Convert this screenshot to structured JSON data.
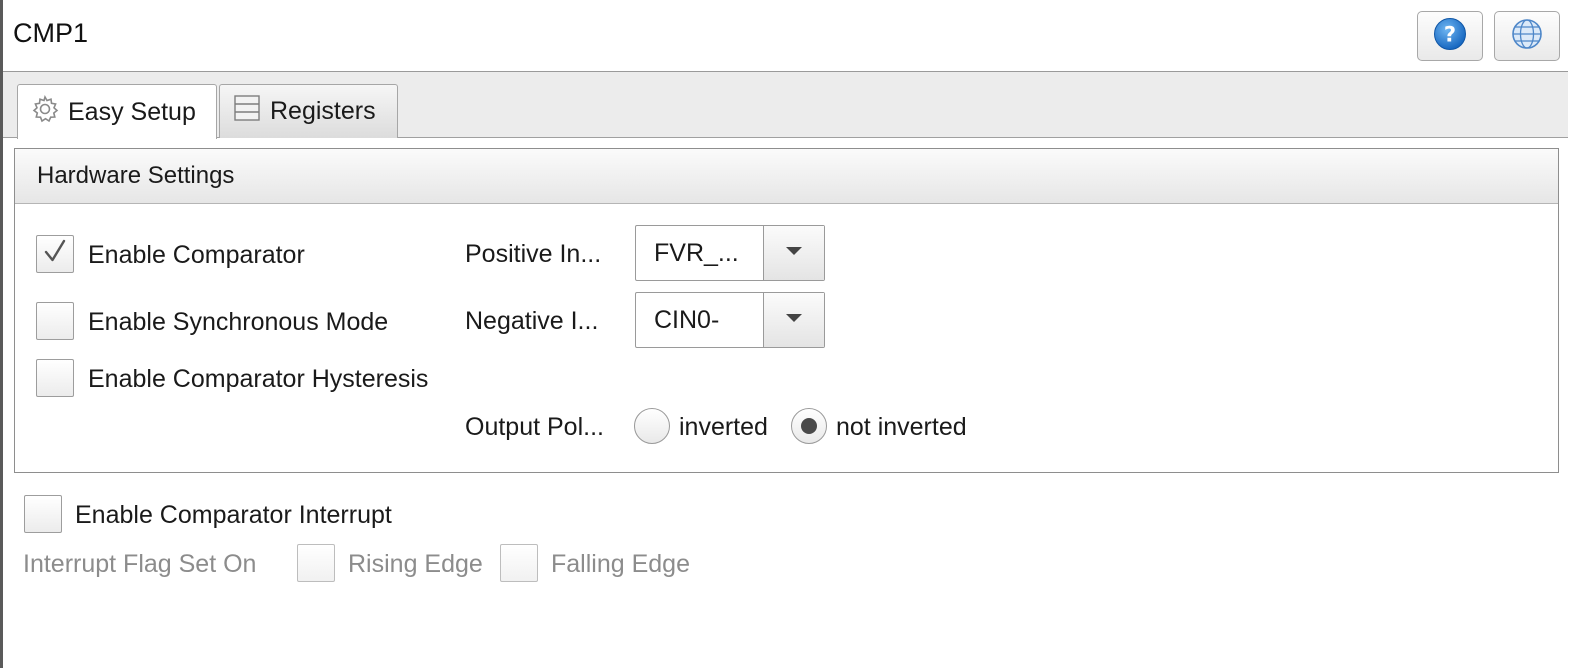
{
  "window": {
    "title": "CMP1"
  },
  "toolbar": {
    "help_icon": "question-mark-icon",
    "globe_icon": "globe-icon"
  },
  "tabs": [
    {
      "label": "Easy Setup",
      "icon": "gear-icon",
      "active": true
    },
    {
      "label": "Registers",
      "icon": "list-icon",
      "active": false
    }
  ],
  "hardware": {
    "header": "Hardware Settings",
    "enable_comparator": {
      "label": "Enable Comparator",
      "checked": true
    },
    "enable_sync": {
      "label": "Enable Synchronous Mode",
      "checked": false
    },
    "enable_hysteresis": {
      "label": "Enable Comparator Hysteresis",
      "checked": false
    },
    "positive_input": {
      "label": "Positive In...",
      "value": "FVR_..."
    },
    "negative_input": {
      "label": "Negative I...",
      "value": "CIN0-"
    },
    "output_polarity": {
      "label": "Output Pol...",
      "options": [
        "inverted",
        "not inverted"
      ],
      "selected": "not inverted"
    }
  },
  "interrupt": {
    "enable": {
      "label": "Enable Comparator Interrupt",
      "checked": false
    },
    "flag_label": "Interrupt Flag Set On",
    "rising": {
      "label": "Rising Edge",
      "checked": false
    },
    "falling": {
      "label": "Falling Edge",
      "checked": false
    }
  },
  "colors": {
    "help_blue": "#1f7fd6",
    "border": "#9a9a9a",
    "dim_text": "#8c8c8c"
  }
}
